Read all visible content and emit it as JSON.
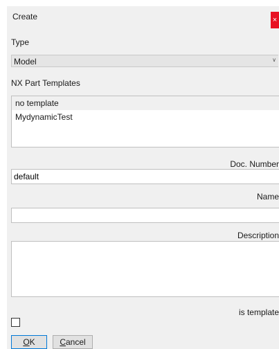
{
  "window": {
    "title": "Create",
    "close_glyph": "×"
  },
  "type_section": {
    "label": "Type",
    "selected": "Model",
    "arrow_icon": "chevron-down-icon"
  },
  "templates_section": {
    "label": "NX Part Templates",
    "items": [
      {
        "label": "no template",
        "selected": true
      },
      {
        "label": "MydynamicTest",
        "selected": false
      }
    ]
  },
  "doc_number": {
    "label": "Doc. Number",
    "value": "default"
  },
  "name_field": {
    "label": "Name",
    "value": ""
  },
  "description_field": {
    "label": "Description",
    "value": ""
  },
  "is_template": {
    "label": "is template",
    "checked": false
  },
  "buttons": {
    "ok": {
      "mnemonic": "O",
      "rest": "K"
    },
    "cancel": {
      "mnemonic": "C",
      "rest": "ancel"
    }
  }
}
